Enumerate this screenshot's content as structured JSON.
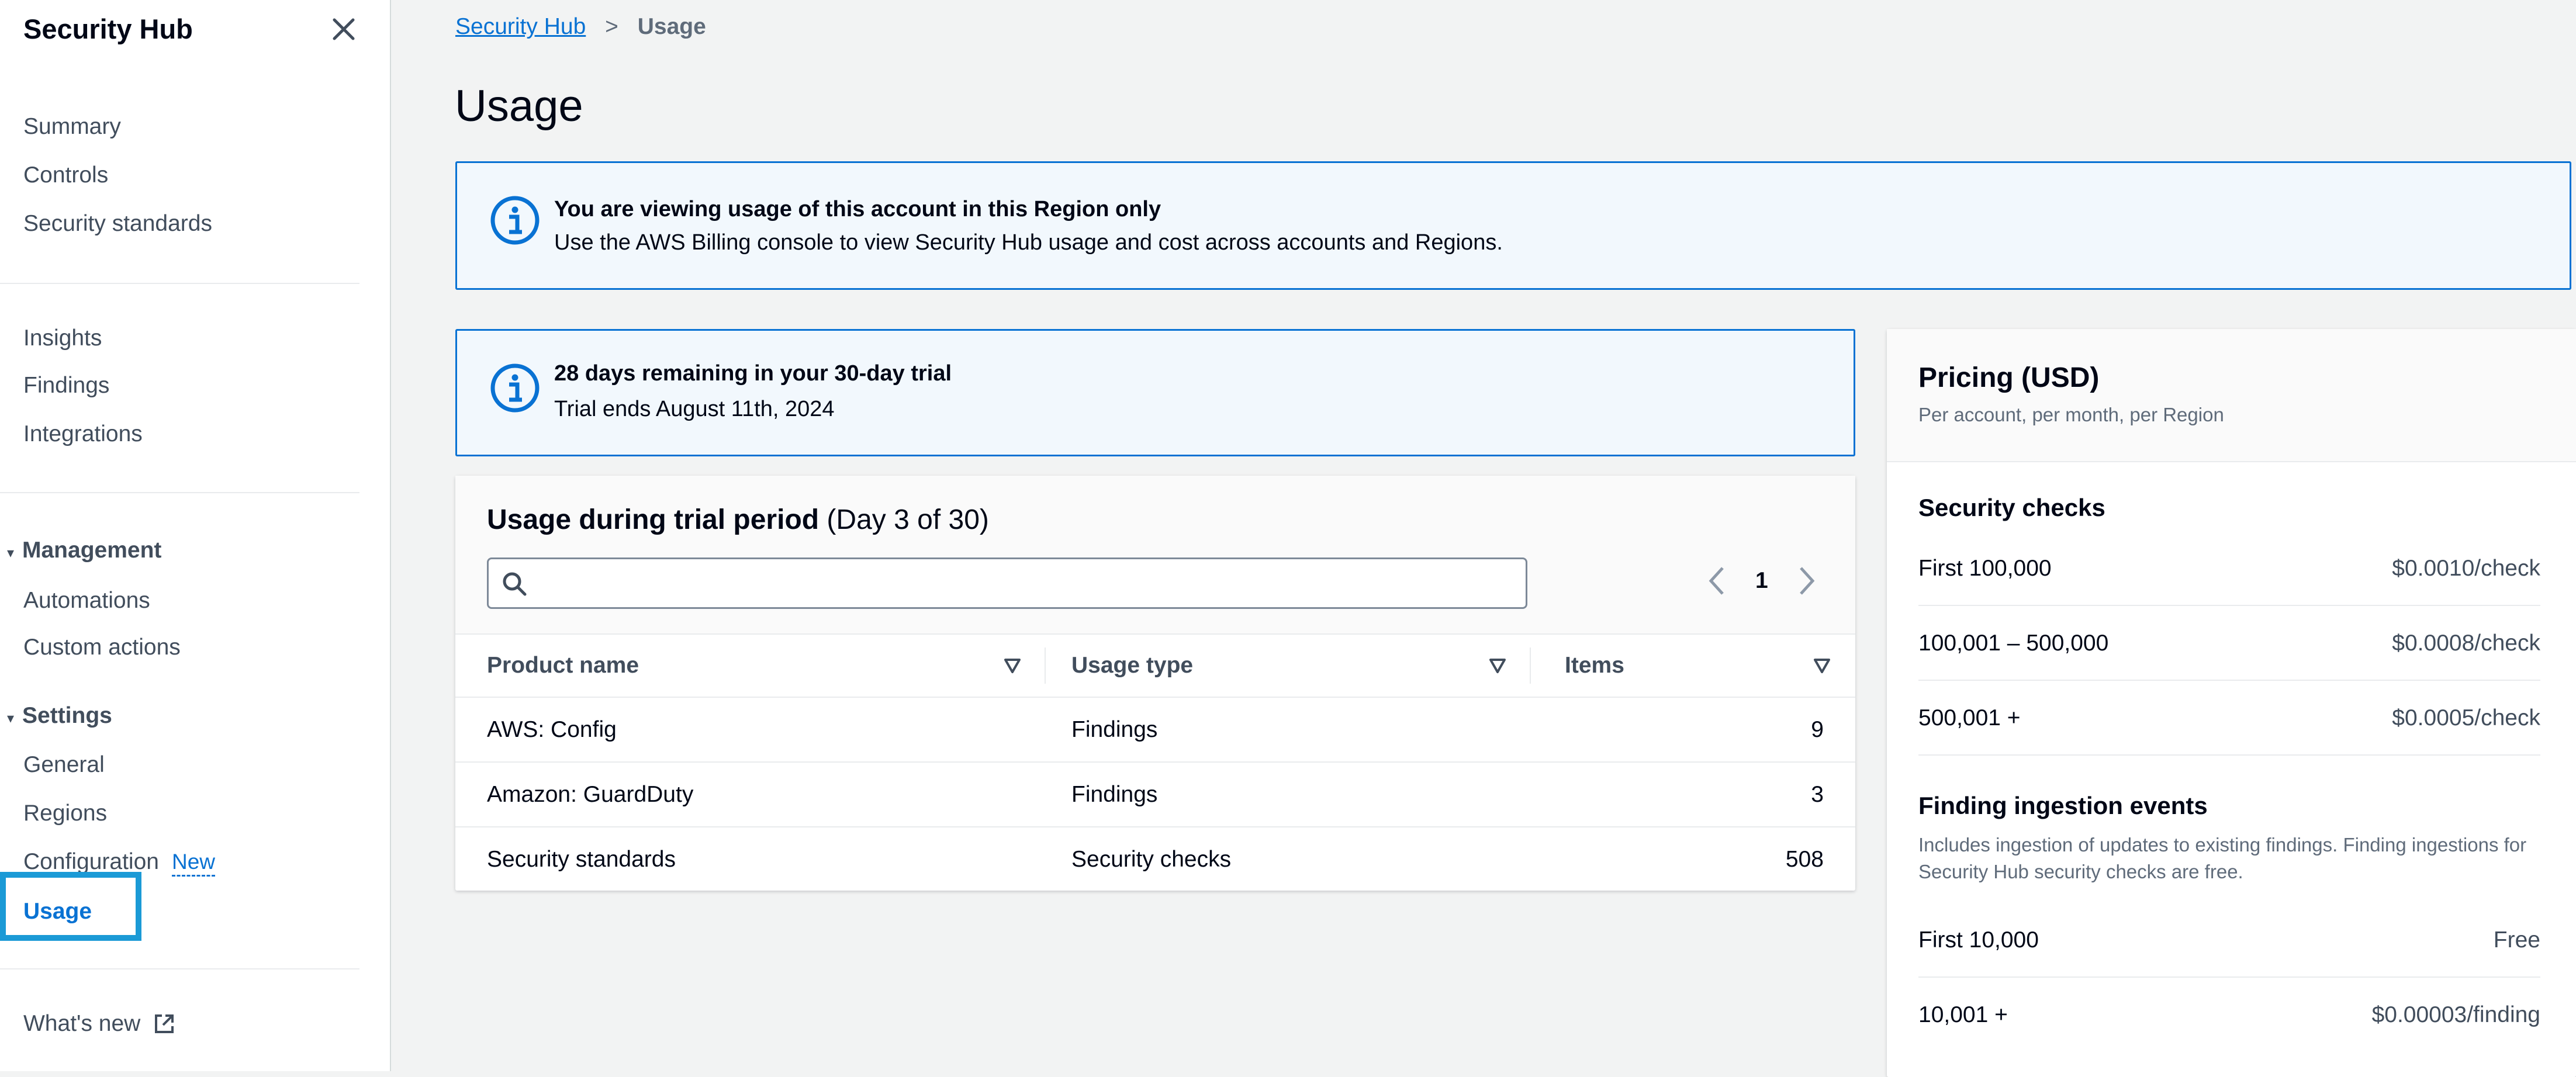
{
  "sidebar": {
    "title": "Security Hub",
    "group1": [
      "Summary",
      "Controls",
      "Security standards"
    ],
    "group2": [
      "Insights",
      "Findings",
      "Integrations"
    ],
    "management": {
      "label": "Management",
      "items": [
        "Automations",
        "Custom actions"
      ]
    },
    "settings": {
      "label": "Settings",
      "items": [
        "General",
        "Regions",
        "Configuration",
        "Usage"
      ],
      "new_badge": "New"
    },
    "whats_new": "What's new"
  },
  "breadcrumb": {
    "parent": "Security Hub",
    "separator": ">",
    "current": "Usage"
  },
  "page_title": "Usage",
  "region_alert": {
    "title": "You are viewing usage of this account in this Region only",
    "text": "Use the AWS Billing console to view Security Hub usage and cost across accounts and Regions."
  },
  "trial_alert": {
    "title": "28 days remaining in your 30-day trial",
    "text": "Trial ends August 11th, 2024"
  },
  "usage_table": {
    "title": "Usage during trial period",
    "subtitle": "(Day 3 of 30)",
    "search_placeholder": "",
    "page": "1",
    "columns": [
      "Product name",
      "Usage type",
      "Items"
    ],
    "rows": [
      [
        "AWS: Config",
        "Findings",
        "9"
      ],
      [
        "Amazon: GuardDuty",
        "Findings",
        "3"
      ],
      [
        "Security standards",
        "Security checks",
        "508"
      ]
    ]
  },
  "pricing": {
    "title": "Pricing (USD)",
    "subtitle": "Per account, per month, per Region",
    "security_checks": {
      "label": "Security checks",
      "rows": [
        [
          "First 100,000",
          "$0.0010/check"
        ],
        [
          "100,001 – 500,000",
          "$0.0008/check"
        ],
        [
          "500,001 +",
          "$0.0005/check"
        ]
      ]
    },
    "finding_ingestion": {
      "label": "Finding ingestion events",
      "description": "Includes ingestion of updates to existing findings. Finding ingestions for Security Hub security checks are free.",
      "rows": [
        [
          "First 10,000",
          "Free"
        ],
        [
          "10,001 +",
          "$0.00003/finding"
        ]
      ]
    }
  },
  "colors": {
    "link": "#0972d3",
    "info_border": "#0972d3",
    "info_bg": "#f2f8fd",
    "highlight": "#1b9ad6",
    "page_bg": "#f2f3f3"
  }
}
